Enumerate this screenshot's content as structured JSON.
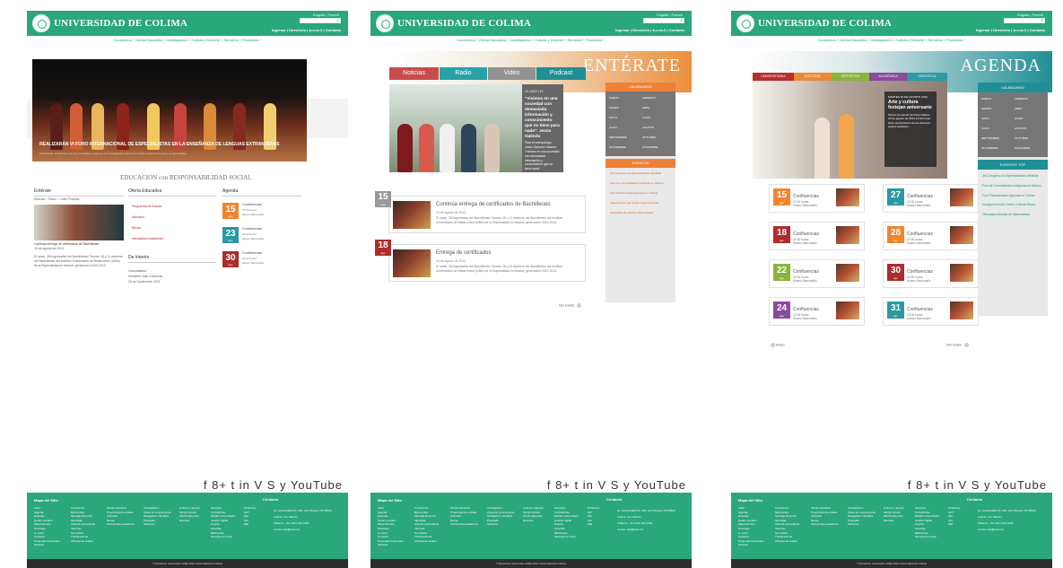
{
  "site": {
    "name": "UNIVERSIDAD DE COLIMA",
    "languages": "English | French",
    "utility": "Ingresar | Directorio | A-o-la-Z | Contacto",
    "menu": "Conócenos + Oferta Educativa + Investigación + Cultura y Deporte + Servicios + Productos +",
    "search_placeholder": ""
  },
  "panel1": {
    "hero_caption": "REALIZARÁN VI FORO INTERNACIONAL DE ESPECIALISTAS EN LA ENSEÑANZA DE LENGUAS EXTRANJERAS",
    "hero_sub": "Participarán académicos de los principales congresos de investigación para su formación para la docencia y el aprendizaje.",
    "mission": "EDUCACIÓN con RESPONSABILIDAD SOCIAL",
    "entrate": "Entérate",
    "entrate_tabs": "Noticias + Radio + Video Podcast",
    "news_title": "Continúa entrega de certificados de Bachillerato",
    "news_date": "15 de agosto de 2013",
    "news_body": "El lunes, 253 egresados del Bachillerato Técnico 16 y 11 alumnos del Bachillerato del Instituto Universitario de Bellas Artes (IUBA) de la Especialidad en Música, generación 2010-2013.",
    "oferta": "Oferta Educativa",
    "links": [
      "Programas de Estudio",
      "Admisión",
      "Becas",
      "Intercambio Académico"
    ],
    "interes": "De Interés",
    "interes_title": "Convocatoria",
    "interes_meta": "Mediante Juan Contreras",
    "interes_date": "25 de Septiembre 2013",
    "agenda": "Agenda",
    "events": [
      {
        "day": "15",
        "month": "ago",
        "title": "Confluencias",
        "meta": "20:30 horas",
        "place": "Museo Manzanillo",
        "color": "#f0852e"
      },
      {
        "day": "23",
        "month": "ago",
        "title": "Confluencias",
        "meta": "20:30 horas",
        "place": "Museo Manzanillo",
        "color": "#2a99a4"
      },
      {
        "day": "30",
        "month": "ago",
        "title": "Confluencias",
        "meta": "20:30 horas",
        "place": "Museo Manzanillo",
        "color": "#ad2c2c"
      }
    ]
  },
  "panel2": {
    "banner": "ENTÉRATE",
    "tabs": [
      "Noticias",
      "Radio",
      "Video",
      "Podcast"
    ],
    "tab_colors": [
      "#c84c4c",
      "#27a2a9",
      "#929292",
      "#1f8f96"
    ],
    "feature_date": "13 | AGO | 13",
    "feature_quote": "\"Vivimos en una sociedad con demasiada información y conocimiento que no tiene para nada\": Jesús Galindo",
    "feature_body": "Para el antropólogo Jesús Galindo Cáceres \"vivimos en una sociedad con demasiada información y conocimiento que no tiene nada\".",
    "calendar": "CALENDARIO",
    "months": [
      "ENERO",
      "FEBRERO",
      "MARZO",
      "ABRIL",
      "MAYO",
      "JUNIO",
      "JULIO",
      "AGOSTO",
      "SEPTIEMBRE",
      "OCTUBRE",
      "NOVIEMBRE",
      "DICIEMBRE"
    ],
    "events_head": "EVENTOS",
    "events": [
      "3er Congreso de Especialidades Médicas",
      "Foro de Comunidades Indígenas en México",
      "Foro Parlamentario Agrícola en Colima",
      "Inauguración del Centro Cultural Reyes",
      "Olimpiada Mundial de Matemáticas"
    ],
    "news": [
      {
        "day": "15",
        "month": "ago",
        "color": "#999999",
        "title": "Continúa entrega de certificados de Bachillerato",
        "meta": "15 de Agosto de 2013",
        "body": "El lunes, 253 egresados del Bachillerato Técnico 16 y 11 alumnos del Bachillerato del Instituto Universitario de Bellas Artes (IUBA) de la Especialidad en Música, generación 2010-2013."
      },
      {
        "day": "18",
        "month": "ago",
        "color": "#ad2c2c",
        "title": "Entrega de certificados",
        "meta": "18 de Agosto de 2013",
        "body": "El lunes, 253 egresados del Bachillerato Técnico 16 y 11 alumnos del Bachillerato del Instituto Universitario de Bellas Artes (IUBA) de la Especialidad en Música, generación 2010-2013."
      }
    ],
    "see_all": "Ver todos"
  },
  "panel3": {
    "banner": "AGENDA",
    "tabs": [
      "UNIVERSITARIA",
      "CULTURAL",
      "DEPORTIVA",
      "ACADÉMICA",
      "CIENTÍFICA"
    ],
    "tab_colors": [
      "#b82e2e",
      "#ec8a35",
      "#89b33b",
      "#8a4aa0",
      "#2b9ca3"
    ],
    "feature_date": "MARTES 20 DE AGOSTO 2013",
    "feature_title": "Arte y cultura festejan aniversario",
    "feature_body": "Museo Fernando del Paso Martes 20 de agosto de 2013 12:00 horas. Gran presentación de los diversos grupos artísticos.",
    "calendar": "CALENDARIO",
    "months": [
      "ENERO",
      "FEBRERO",
      "MARZO",
      "ABRIL",
      "MAYO",
      "JUNIO",
      "JULIO",
      "AGOSTO",
      "SEPTIEMBRE",
      "OCTUBRE",
      "NOVIEMBRE",
      "DICIEMBRE"
    ],
    "events_top": "EVENTOS TOP",
    "events": [
      "3er Congreso de Especialidades Médicas",
      "Foro de Comunidades Indígenas en México",
      "Foro Parlamentario Agrícola en Colima",
      "Inauguración del Centro Cultural Reyes",
      "Olimpiada Mundial de Matemáticas"
    ],
    "cards": [
      {
        "day": "15",
        "month": "ago",
        "color": "#f0852e",
        "title": "Confluencias",
        "meta": "20:30 horas",
        "place": "Museo Manzanillo"
      },
      {
        "day": "27",
        "month": "ago",
        "color": "#2a99a4",
        "title": "Confluencias",
        "meta": "20:30 horas",
        "place": "Museo Manzanillo"
      },
      {
        "day": "18",
        "month": "ago",
        "color": "#ad2c2c",
        "title": "Confluencias",
        "meta": "20:30 horas",
        "place": "Museo Manzanillo"
      },
      {
        "day": "28",
        "month": "ago",
        "color": "#f0852e",
        "title": "Confluencias",
        "meta": "20:30 horas",
        "place": "Museo Manzanillo"
      },
      {
        "day": "22",
        "month": "ago",
        "color": "#89b33b",
        "title": "Confluencias",
        "meta": "20:30 horas",
        "place": "Museo Manzanillo"
      },
      {
        "day": "30",
        "month": "ago",
        "color": "#ad2c2c",
        "title": "Confluencias",
        "meta": "20:30 horas",
        "place": "Museo Manzanillo"
      },
      {
        "day": "24",
        "month": "ago",
        "color": "#8a4aa0",
        "title": "Confluencias",
        "meta": "20:30 horas",
        "place": "Museo Manzanillo"
      },
      {
        "day": "31",
        "month": "ago",
        "color": "#2a99a4",
        "title": "Confluencias",
        "meta": "20:30 horas",
        "place": "Museo Manzanillo"
      }
    ],
    "home": "Inicio",
    "see_all": "Ver todos"
  },
  "footer": {
    "title": "Mapa del Sitio",
    "contact": "Contacto",
    "columns": [
      [
        "Inicio",
        "Agenda",
        "Entérate",
        "Redes sociales",
        "Mapa del sitio",
        "Directorio",
        "A-o-la-Z",
        "Contacto",
        "Preguntas frecuentes",
        "Glosario"
      ],
      [
        "Conócenos",
        "Bienvenida",
        "Mensaje Rectoría",
        "Identidad",
        "Historia universitaria",
        "Informes",
        "Normativa",
        "Transparencia",
        "Oficinas de enlace"
      ],
      [
        "Oferta educativa",
        "Programas de estudio",
        "Admisión",
        "Becas",
        "Intercambio académico"
      ],
      [
        "Investigación",
        "Áreas de conocimiento",
        "Divulgación científica",
        "Posgrado",
        "Sistemas"
      ],
      [
        "Cultura y deporte",
        "Oferta cultural",
        "Oferta deportiva",
        "Recintos"
      ],
      [
        "Servicios",
        "Consultorios",
        "Edición universitaria",
        "Gestión digital",
        "Empleo",
        "Librerías",
        "Bibliotecas",
        "Servicios en línea"
      ],
      [
        "Productos",
        "UFT",
        "Fijo",
        "Opt",
        "Sell"
      ]
    ],
    "contact_lines": [
      "Av. Universidad No. 333, Las Víboras, CP 28040",
      "Colima, Col. México",
      "Teléfono: +52 (312) 316 1000",
      "Correo: info@ucol.mx"
    ],
    "copyright": "© Derechos reservados 2000-2013 Universidad de Colima",
    "social": "f 8+ t in V S y YouTube"
  }
}
